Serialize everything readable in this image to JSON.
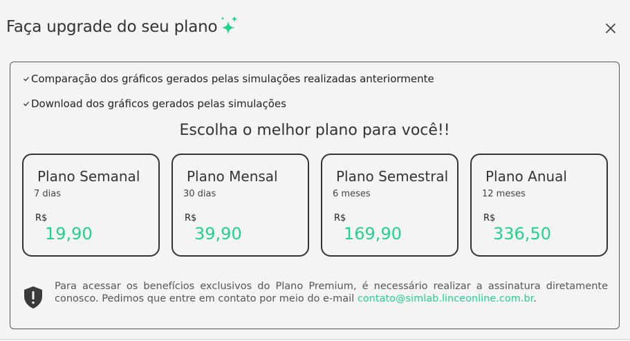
{
  "header": {
    "title": "Faça upgrade do seu plano",
    "sparkle_icon": "sparkle-icon",
    "close_icon": "close-icon"
  },
  "features": [
    {
      "check_icon": "check-icon",
      "text": "Comparação dos gráficos gerados pelas simulações realizadas anteriormente"
    },
    {
      "check_icon": "check-icon",
      "text": "Download dos gráficos gerados pelas simulações"
    }
  ],
  "choose_heading": "Escolha o melhor plano para você!!",
  "plans": [
    {
      "name": "Plano Semanal",
      "period": "7 dias",
      "currency": "R$",
      "price": "19,90"
    },
    {
      "name": "Plano Mensal",
      "period": "30 dias",
      "currency": "R$",
      "price": "39,90"
    },
    {
      "name": "Plano Semestral",
      "period": "6 meses",
      "currency": "R$",
      "price": "169,90"
    },
    {
      "name": "Plano Anual",
      "period": "12 meses",
      "currency": "R$",
      "price": "336,50"
    }
  ],
  "notice": {
    "icon": "shield-alert-icon",
    "text": "Para acessar os benefícios exclusivos do Plano Premium, é necessário realizar a assinatura diretamente conosco. Pedimos que entre em contato por meio do e-mail ",
    "email": "contato@simlab.linceonline.com.br",
    "suffix": "."
  },
  "colors": {
    "accent": "#22d18e",
    "text": "#333333",
    "background": "#f4f4f4",
    "border": "#333333"
  }
}
